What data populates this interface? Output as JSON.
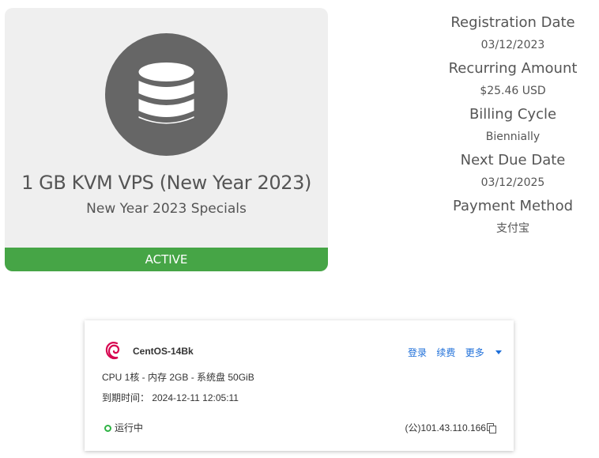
{
  "product": {
    "name": "1 GB KVM VPS (New Year 2023)",
    "group": "New Year 2023 Specials",
    "status": "ACTIVE",
    "icon": "database-icon",
    "status_color": "#46a546",
    "icon_circle_color": "#666666"
  },
  "details": {
    "registration_label": "Registration Date",
    "registration_value": "03/12/2023",
    "recurring_label": "Recurring Amount",
    "recurring_value": "$25.46 USD",
    "cycle_label": "Billing Cycle",
    "cycle_value": "Biennially",
    "due_label": "Next Due Date",
    "due_value": "03/12/2025",
    "payment_label": "Payment Method",
    "payment_value": "支付宝"
  },
  "server": {
    "name": "CentOS-14Bk",
    "logo": "debian-swirl-icon",
    "login": "登录",
    "renew": "续费",
    "more": "更多",
    "specs": "CPU 1核 - 内存 2GB - 系统盘 50GiB",
    "expire": "到期时间：  2024-12-11 12:05:11",
    "status": "运行中",
    "status_color": "#2fb344",
    "ip": "(公)101.43.110.166",
    "link_color": "#1e6fd9"
  }
}
